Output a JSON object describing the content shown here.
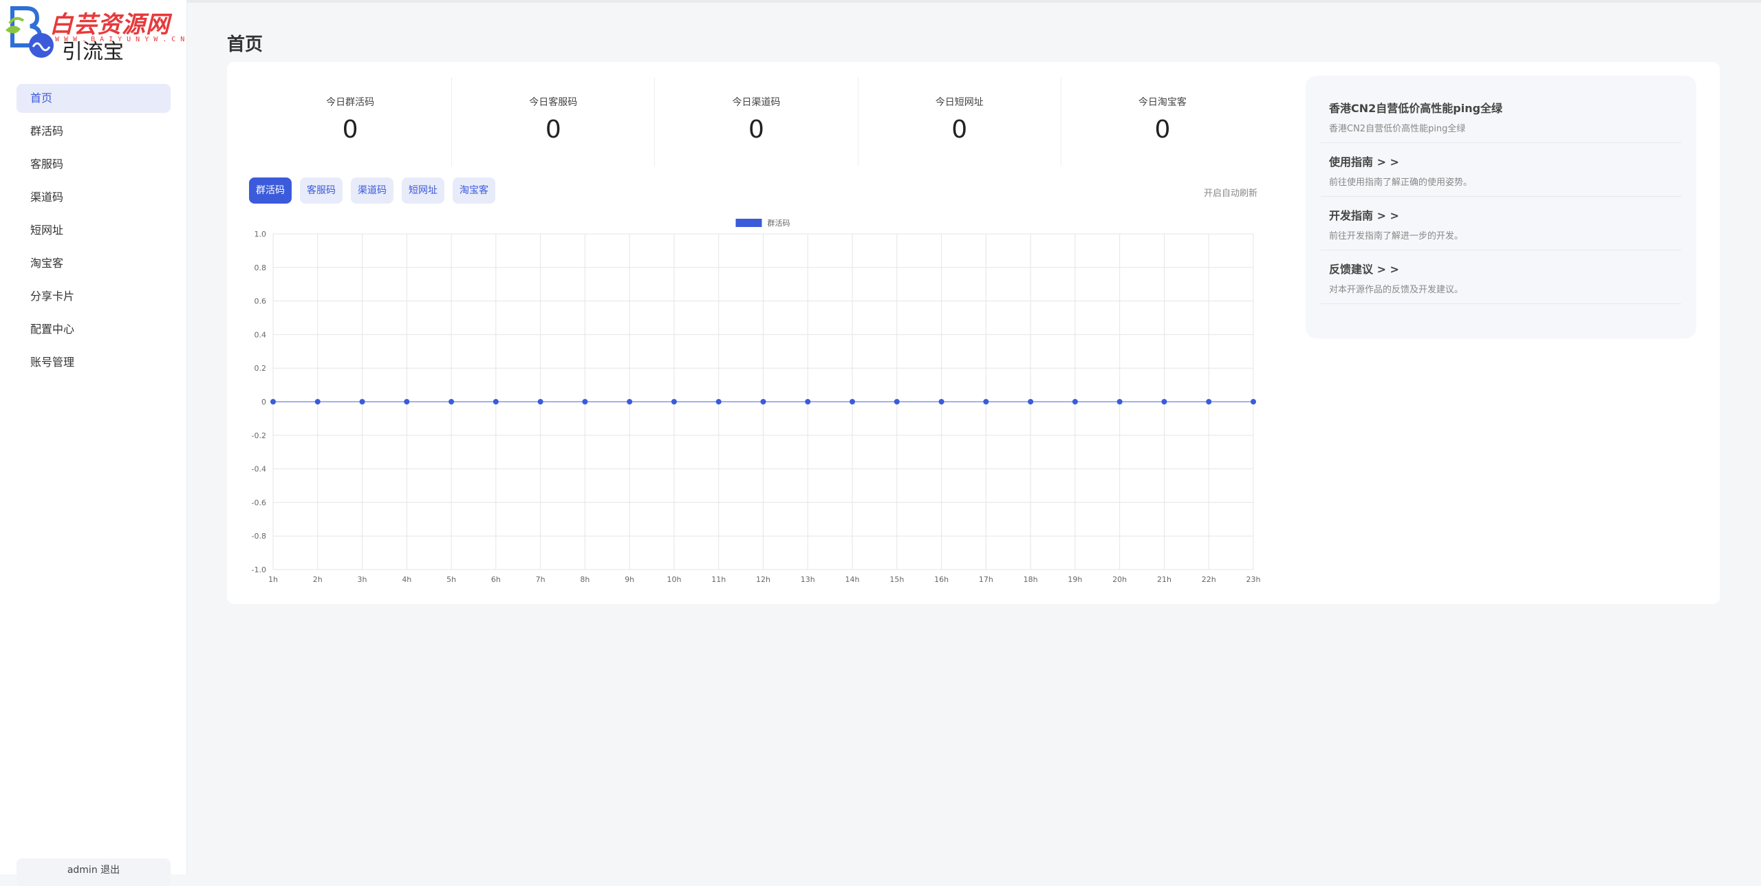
{
  "logo": {
    "watermark_text": "白芸资源网",
    "watermark_url": "WWW.BAIYUNYW.CN",
    "app_name": "引流宝"
  },
  "sidebar": {
    "items": [
      {
        "label": "首页",
        "active": true
      },
      {
        "label": "群活码",
        "active": false
      },
      {
        "label": "客服码",
        "active": false
      },
      {
        "label": "渠道码",
        "active": false
      },
      {
        "label": "短网址",
        "active": false
      },
      {
        "label": "淘宝客",
        "active": false
      },
      {
        "label": "分享卡片",
        "active": false
      },
      {
        "label": "配置中心",
        "active": false
      },
      {
        "label": "账号管理",
        "active": false
      }
    ],
    "user": "admin 退出"
  },
  "page_title": "首页",
  "stats": [
    {
      "label": "今日群活码",
      "value": "0"
    },
    {
      "label": "今日客服码",
      "value": "0"
    },
    {
      "label": "今日渠道码",
      "value": "0"
    },
    {
      "label": "今日短网址",
      "value": "0"
    },
    {
      "label": "今日淘宝客",
      "value": "0"
    }
  ],
  "tabs": [
    {
      "label": "群活码",
      "active": true
    },
    {
      "label": "客服码",
      "active": false
    },
    {
      "label": "渠道码",
      "active": false
    },
    {
      "label": "短网址",
      "active": false
    },
    {
      "label": "淘宝客",
      "active": false
    }
  ],
  "auto_refresh": "开启自动刷新",
  "chart_data": {
    "type": "line",
    "x": [
      "1h",
      "2h",
      "3h",
      "4h",
      "5h",
      "6h",
      "7h",
      "8h",
      "9h",
      "10h",
      "11h",
      "12h",
      "13h",
      "14h",
      "15h",
      "16h",
      "17h",
      "18h",
      "19h",
      "20h",
      "21h",
      "22h",
      "23h"
    ],
    "series": [
      {
        "name": "群活码",
        "values": [
          0,
          0,
          0,
          0,
          0,
          0,
          0,
          0,
          0,
          0,
          0,
          0,
          0,
          0,
          0,
          0,
          0,
          0,
          0,
          0,
          0,
          0,
          0
        ]
      }
    ],
    "ylim": [
      -1.0,
      1.0
    ],
    "yticks": [
      "1.0",
      "0.8",
      "0.6",
      "0.4",
      "0.2",
      "0",
      "-0.2",
      "-0.4",
      "-0.6",
      "-0.8",
      "-1.0"
    ],
    "grid": true,
    "legend": "top-center",
    "color": "#3b5bdb"
  },
  "side_panel": [
    {
      "title": "香港CN2自营低价高性能ping全绿",
      "desc": "香港CN2自营低价高性能ping全绿"
    },
    {
      "title": "使用指南 > >",
      "desc": "前往使用指南了解正确的使用姿势。"
    },
    {
      "title": "开发指南 > >",
      "desc": "前往开发指南了解进一步的开发。"
    },
    {
      "title": "反馈建议 > >",
      "desc": "对本开源作品的反馈及开发建议。"
    }
  ]
}
